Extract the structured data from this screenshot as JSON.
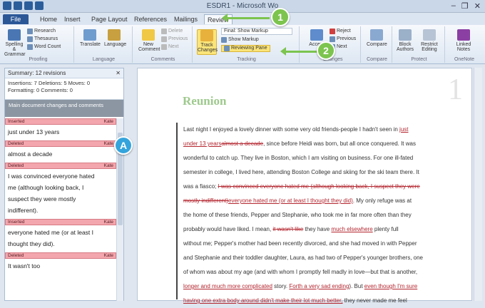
{
  "window": {
    "title": "ESDR1 - Microsoft Wo",
    "controls": [
      "–",
      "❐",
      "✕"
    ]
  },
  "tabs": [
    {
      "label": "File"
    },
    {
      "label": "Home"
    },
    {
      "label": "Insert"
    },
    {
      "label": "Page Layout"
    },
    {
      "label": "References"
    },
    {
      "label": "Mailings"
    },
    {
      "label": "Review"
    }
  ],
  "ribbon": {
    "proofing": {
      "label": "Proofing",
      "spelling": "Spelling & Grammar",
      "research": "Research",
      "thesaurus": "Thesaurus",
      "word_count": "Word Count"
    },
    "language": {
      "label": "Language",
      "translate": "Translate",
      "language": "Language"
    },
    "comments": {
      "label": "Comments",
      "new_comment": "New Comment",
      "delete": "Delete",
      "previous": "Previous",
      "next": "Next"
    },
    "tracking": {
      "label": "Tracking",
      "track_changes": "Track Changes",
      "final_showing_markup": "Final: Show Markup",
      "show_markup": "Show Markup",
      "reviewing_pane": "Reviewing Pane"
    },
    "changes": {
      "label": "Changes",
      "accept": "Accept",
      "reject": "Reject",
      "previous": "Previous",
      "next": "Next"
    },
    "compare": {
      "label": "Compare",
      "compare": "Compare"
    },
    "protect": {
      "label": "Protect",
      "block_authors": "Block Authors",
      "restrict_editing": "Restrict Editing"
    },
    "onenote": {
      "label": "OneNote",
      "linked_notes": "Linked Notes"
    }
  },
  "reviewing_pane": {
    "title": "Summary: 12 revisions",
    "summary_line1": "Insertions: 7  Deletions: 5  Moves: 0",
    "summary_line2": "Formatting: 0  Comments: 0",
    "main_header": "Main document changes and comments",
    "revisions": [
      {
        "type": "Inserted",
        "author": "Kate",
        "text": "just under 13 years"
      },
      {
        "type": "Deleted",
        "author": "Kate",
        "text": "almost a decade"
      },
      {
        "type": "Deleted",
        "author": "Kate",
        "lines": [
          "I was convinced everyone hated",
          "me (although looking back, I",
          "suspect they were mostly",
          "indifferent)."
        ]
      },
      {
        "type": "Inserted",
        "author": "Kate",
        "lines": [
          "everyone hated me (or at least I",
          "thought they did)."
        ]
      },
      {
        "type": "Deleted",
        "author": "Kate",
        "text": "It wasn't too"
      }
    ]
  },
  "document": {
    "page_number": "1",
    "title": "Reunion",
    "lines": [
      [
        {
          "t": "Last night I enjoyed a lovely dinner with some very old friends-people I hadn't seen in "
        },
        {
          "t": "just",
          "c": "ins"
        }
      ],
      [
        {
          "t": "under 13 years",
          "c": "ins"
        },
        {
          "t": "almost a decade",
          "c": "del"
        },
        {
          "t": ", since before Heidi was born, but all once conquered. It was"
        }
      ],
      [
        {
          "t": "wonderful to catch up. They live in Boston, which I am visiting on business. For one ill-fated"
        }
      ],
      [
        {
          "t": "semester in college, I lived here, attending Boston College and skiing for the ski team there. It"
        }
      ],
      [
        {
          "t": "was a fiasco; "
        },
        {
          "t": "I was convinced everyone hated me (although looking back, I suspect they were",
          "c": "del"
        }
      ],
      [
        {
          "t": "mostly indifferent)",
          "c": "del"
        },
        {
          "t": "everyone hated me (or at least I thought they did)",
          "c": "ins"
        },
        {
          "t": ". My only refuge was at"
        }
      ],
      [
        {
          "t": "the home of these friends, Pepper and Stephanie, who took me in far more often than they"
        }
      ],
      [
        {
          "t": "probably would have liked. I mean, "
        },
        {
          "t": "it wasn't like",
          "c": "del"
        },
        {
          "t": " they have "
        },
        {
          "t": "much elsewhere",
          "c": "ins"
        },
        {
          "t": " plenty full"
        }
      ],
      [
        {
          "t": "without me; Pepper's mother had been recently divorced, and she had moved in with Pepper"
        }
      ],
      [
        {
          "t": "and Stephanie and their toddler daughter, Laura, as had two of Pepper's younger brothers, one"
        }
      ],
      [
        {
          "t": "of whom was about my age (and with whom I promptly fell madly in love—but that is another,"
        }
      ],
      [
        {
          "t": "longer and much more complicated",
          "c": "ins"
        },
        {
          "t": " story. "
        },
        {
          "t": "Forth a very sad ending",
          "c": "ins"
        },
        {
          "t": "). But "
        },
        {
          "t": "even though I'm sure",
          "c": "ins"
        }
      ],
      [
        {
          "t": "having one extra body around didn't make their lot much better,",
          "c": "ins"
        },
        {
          "t": " they never made me feel"
        }
      ]
    ]
  },
  "callouts": {
    "one": "1",
    "two": "2",
    "a": "A"
  }
}
